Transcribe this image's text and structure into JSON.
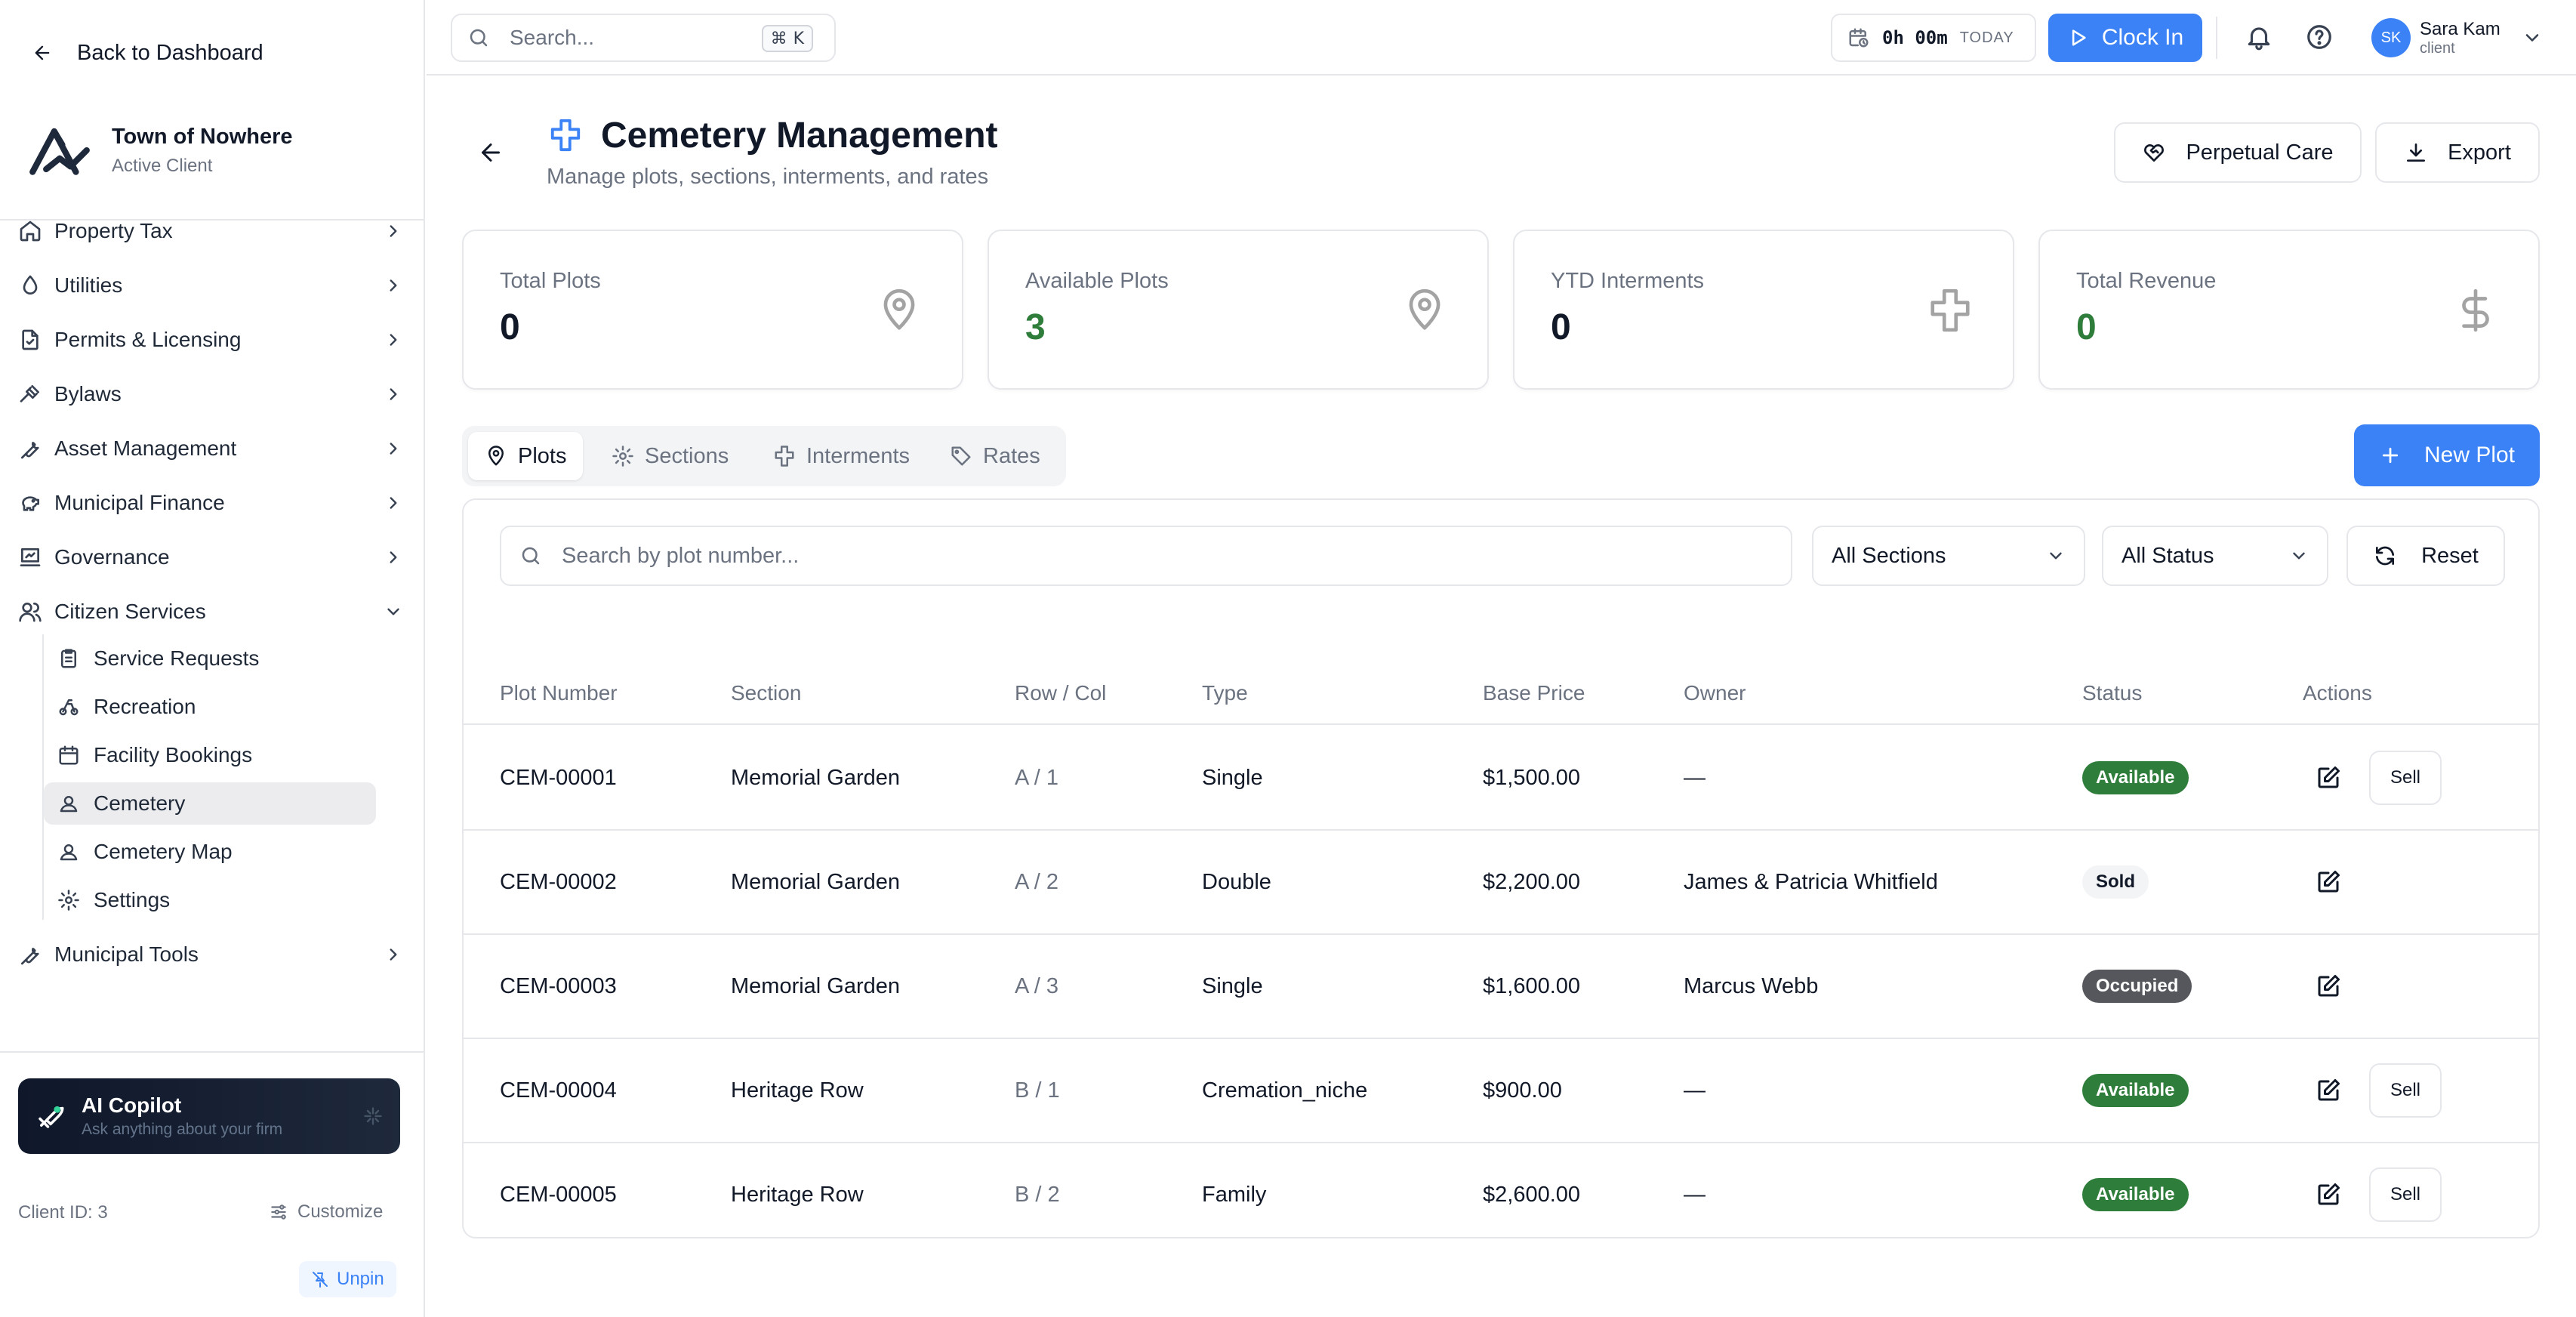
{
  "sidebar": {
    "back_label": "Back to Dashboard",
    "client_name": "Town of Nowhere",
    "client_status": "Active Client",
    "nav": [
      {
        "label": "Property Tax",
        "icon": "home-icon"
      },
      {
        "label": "Utilities",
        "icon": "droplet-icon"
      },
      {
        "label": "Permits & Licensing",
        "icon": "file-check-icon"
      },
      {
        "label": "Bylaws",
        "icon": "gavel-icon"
      },
      {
        "label": "Asset Management",
        "icon": "wrench-icon"
      },
      {
        "label": "Municipal Finance",
        "icon": "piggy-bank-icon"
      },
      {
        "label": "Governance",
        "icon": "landmark-icon"
      },
      {
        "label": "Citizen Services",
        "icon": "users-icon"
      }
    ],
    "sub_items": [
      {
        "label": "Service Requests",
        "icon": "clipboard-icon"
      },
      {
        "label": "Recreation",
        "icon": "bike-icon"
      },
      {
        "label": "Facility Bookings",
        "icon": "calendar-icon"
      },
      {
        "label": "Cemetery",
        "icon": "user-square-icon",
        "active": true
      },
      {
        "label": "Cemetery Map",
        "icon": "user-square-icon"
      },
      {
        "label": "Settings",
        "icon": "gear-icon"
      }
    ],
    "tools_label": "Municipal Tools",
    "copilot_title": "AI Copilot",
    "copilot_sub": "Ask anything about your firm",
    "client_id": "Client ID: 3",
    "customize_label": "Customize",
    "unpin_label": "Unpin"
  },
  "topbar": {
    "search_placeholder": "Search...",
    "shortcut_key": "K",
    "timer": "0h 00m",
    "timer_period": "TODAY",
    "clock_in_label": "Clock In",
    "user_initials": "SK",
    "user_name": "Sara Kam",
    "user_role": "client"
  },
  "page": {
    "title": "Cemetery Management",
    "subtitle": "Manage plots, sections, interments, and rates",
    "perpetual_care_label": "Perpetual Care",
    "export_label": "Export"
  },
  "stats": [
    {
      "label": "Total Plots",
      "value": "0",
      "icon": "map-pin-icon",
      "green": false
    },
    {
      "label": "Available Plots",
      "value": "3",
      "icon": "map-pin-icon",
      "green": true
    },
    {
      "label": "YTD Interments",
      "value": "0",
      "icon": "cross-icon",
      "green": false
    },
    {
      "label": "Total Revenue",
      "value": "0",
      "icon": "dollar-icon",
      "green": true
    }
  ],
  "tabs": [
    {
      "label": "Plots",
      "icon": "map-pin-icon",
      "active": true
    },
    {
      "label": "Sections",
      "icon": "gear-icon"
    },
    {
      "label": "Interments",
      "icon": "cross-icon"
    },
    {
      "label": "Rates",
      "icon": "tag-icon"
    }
  ],
  "new_plot_label": "New Plot",
  "filters": {
    "search_placeholder": "Search by plot number...",
    "section_selected": "All Sections",
    "status_selected": "All Status",
    "reset_label": "Reset"
  },
  "table": {
    "columns": [
      "Plot Number",
      "Section",
      "Row / Col",
      "Type",
      "Base Price",
      "Owner",
      "Status",
      "Actions"
    ],
    "sell_label": "Sell",
    "rows": [
      {
        "plot": "CEM-00001",
        "section": "Memorial Garden",
        "rowcol": "A / 1",
        "type": "Single",
        "price": "$1,500.00",
        "owner": "—",
        "status": "Available",
        "status_kind": "available",
        "sell": true
      },
      {
        "plot": "CEM-00002",
        "section": "Memorial Garden",
        "rowcol": "A / 2",
        "type": "Double",
        "price": "$2,200.00",
        "owner": "James & Patricia Whitfield",
        "status": "Sold",
        "status_kind": "sold",
        "sell": false
      },
      {
        "plot": "CEM-00003",
        "section": "Memorial Garden",
        "rowcol": "A / 3",
        "type": "Single",
        "price": "$1,600.00",
        "owner": "Marcus Webb",
        "status": "Occupied",
        "status_kind": "occupied",
        "sell": false
      },
      {
        "plot": "CEM-00004",
        "section": "Heritage Row",
        "rowcol": "B / 1",
        "type": "Cremation_niche",
        "price": "$900.00",
        "owner": "—",
        "status": "Available",
        "status_kind": "available",
        "sell": true
      },
      {
        "plot": "CEM-00005",
        "section": "Heritage Row",
        "rowcol": "B / 2",
        "type": "Family",
        "price": "$2,600.00",
        "owner": "—",
        "status": "Available",
        "status_kind": "available",
        "sell": true
      }
    ]
  },
  "colors": {
    "accent": "#3b82f6",
    "available": "#2e7d3a",
    "occupied": "#55575c"
  }
}
